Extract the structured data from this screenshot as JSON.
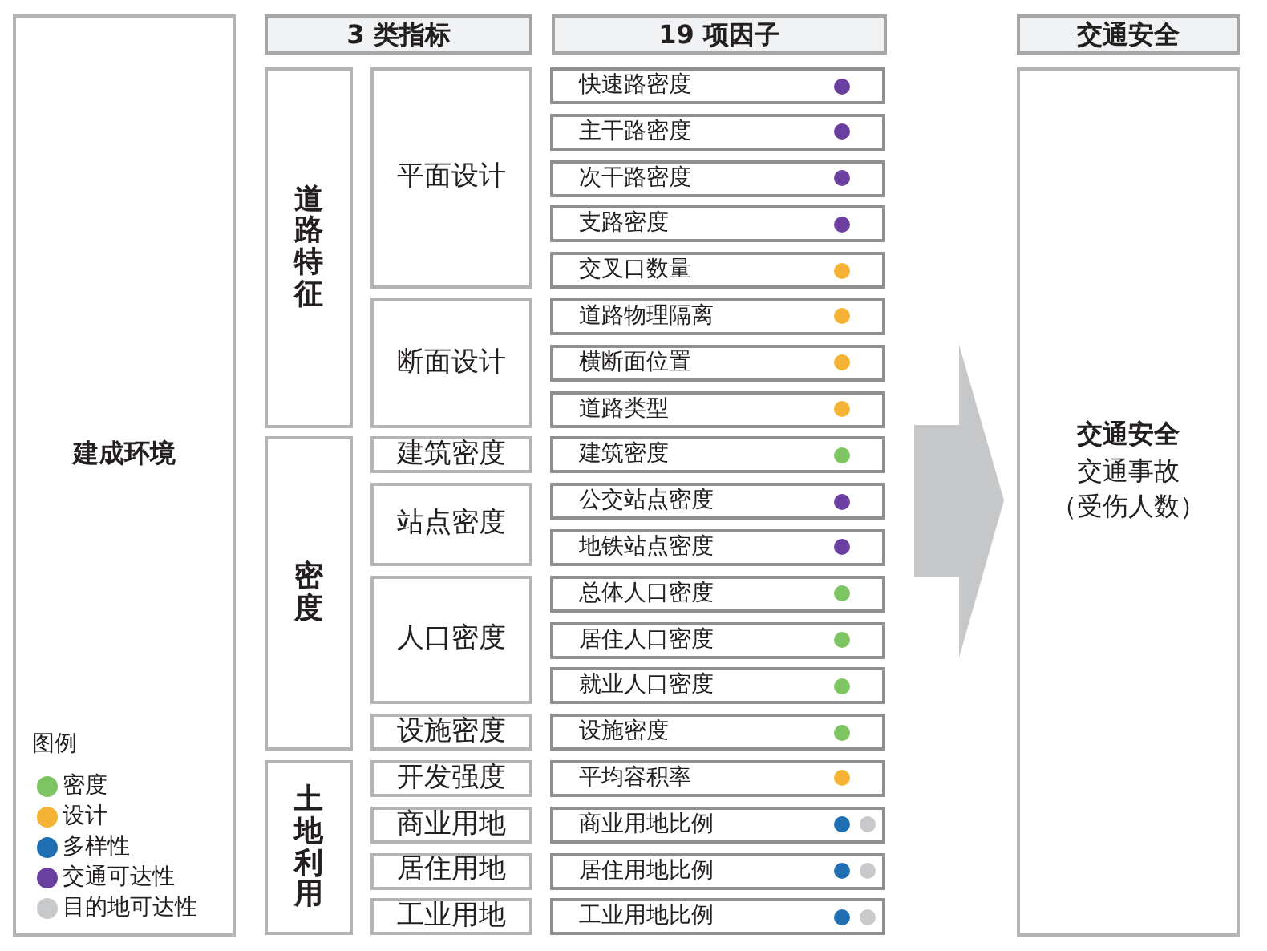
{
  "left_panel": {
    "title": "建成环境",
    "legend": {
      "title": "图例",
      "items": [
        {
          "label": "密度",
          "color": "#7dc462"
        },
        {
          "label": "设计",
          "color": "#f5b335"
        },
        {
          "label": "多样性",
          "color": "#1f6fb2"
        },
        {
          "label": "交通可达性",
          "color": "#6b3fa0"
        },
        {
          "label": "目的地可达性",
          "color": "#c8c9cb"
        }
      ]
    }
  },
  "headers": [
    "3 类指标",
    "19 项因子"
  ],
  "categories": [
    {
      "label": "道路特征",
      "subs": [
        {
          "label": "平面设计",
          "factors": [
            {
              "label": "快速路密度",
              "dots": [
                {
                  "color": "#6b3fa0"
                }
              ]
            },
            {
              "label": "主干路密度",
              "dots": [
                {
                  "color": "#6b3fa0"
                }
              ]
            },
            {
              "label": "次干路密度",
              "dots": [
                {
                  "color": "#6b3fa0"
                }
              ]
            },
            {
              "label": "支路密度",
              "dots": [
                {
                  "color": "#6b3fa0"
                }
              ]
            },
            {
              "label": "交叉口数量",
              "dots": [
                {
                  "color": "#f5b335"
                }
              ]
            }
          ]
        },
        {
          "label": "断面设计",
          "factors": [
            {
              "label": "道路物理隔离",
              "dots": [
                {
                  "color": "#f5b335"
                }
              ]
            },
            {
              "label": "横断面位置",
              "dots": [
                {
                  "color": "#f5b335"
                }
              ]
            },
            {
              "label": "道路类型",
              "dots": [
                {
                  "color": "#f5b335"
                }
              ]
            }
          ]
        }
      ]
    },
    {
      "label": "密度",
      "subs": [
        {
          "label": "建筑密度",
          "factors": [
            {
              "label": "建筑密度",
              "dots": [
                {
                  "color": "#7dc462"
                }
              ]
            }
          ]
        },
        {
          "label": "站点密度",
          "factors": [
            {
              "label": "公交站点密度",
              "dots": [
                {
                  "color": "#6b3fa0"
                }
              ]
            },
            {
              "label": "地铁站点密度",
              "dots": [
                {
                  "color": "#6b3fa0"
                }
              ]
            }
          ]
        },
        {
          "label": "人口密度",
          "factors": [
            {
              "label": "总体人口密度",
              "dots": [
                {
                  "color": "#7dc462"
                }
              ]
            },
            {
              "label": "居住人口密度",
              "dots": [
                {
                  "color": "#7dc462"
                }
              ]
            },
            {
              "label": "就业人口密度",
              "dots": [
                {
                  "color": "#7dc462"
                }
              ]
            }
          ]
        },
        {
          "label": "设施密度",
          "factors": [
            {
              "label": "设施密度",
              "dots": [
                {
                  "color": "#7dc462"
                }
              ]
            }
          ]
        }
      ]
    },
    {
      "label": "土地利用",
      "subs": [
        {
          "label": "开发强度",
          "factors": [
            {
              "label": "平均容积率",
              "dots": [
                {
                  "color": "#f5b335"
                }
              ]
            }
          ]
        },
        {
          "label": "商业用地",
          "factors": [
            {
              "label": "商业用地比例",
              "dots": [
                {
                  "color": "#1f6fb2"
                },
                {
                  "color": "#c8c9cb"
                }
              ]
            }
          ]
        },
        {
          "label": "居住用地",
          "factors": [
            {
              "label": "居住用地比例",
              "dots": [
                {
                  "color": "#1f6fb2"
                },
                {
                  "color": "#c8c9cb"
                }
              ]
            }
          ]
        },
        {
          "label": "工业用地",
          "factors": [
            {
              "label": "工业用地比例",
              "dots": [
                {
                  "color": "#1f6fb2"
                },
                {
                  "color": "#c8c9cb"
                }
              ]
            }
          ]
        }
      ]
    }
  ],
  "outcome": {
    "header": "交通安全",
    "title": "交通安全",
    "lines": [
      "交通事故",
      "（受伤人数）"
    ]
  }
}
